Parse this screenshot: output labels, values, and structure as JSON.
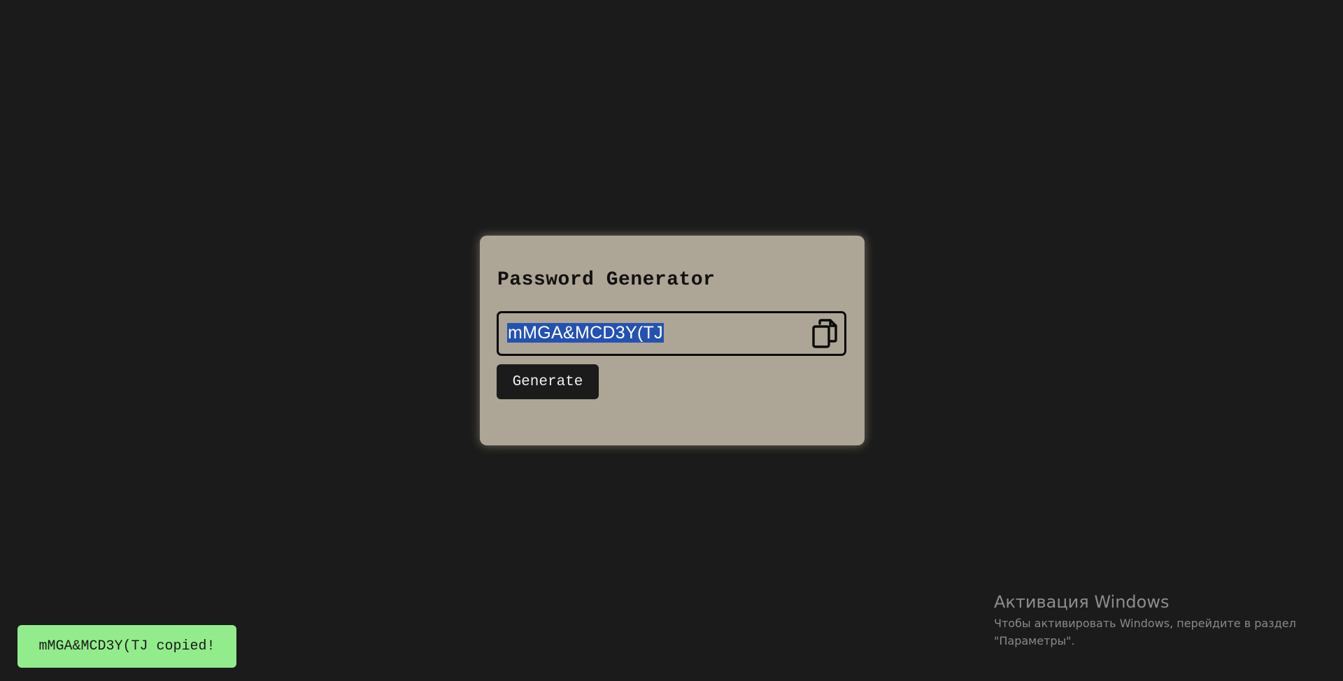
{
  "app": {
    "title": "Password Generator"
  },
  "password_field": {
    "value": "mMGA&MCD3Y(TJ",
    "selected": true,
    "selection_color": "#2452b3"
  },
  "copy_button": {
    "icon": "copy-icon"
  },
  "generate_button": {
    "label": "Generate"
  },
  "toast": {
    "message": "mMGA&MCD3Y(TJ copied!",
    "color": "#92ec8c"
  },
  "windows_watermark": {
    "title": "Активация Windows",
    "text": "Чтобы активировать Windows, перейдите в раздел \"Параметры\"."
  },
  "colors": {
    "background": "#1b1b1b",
    "card": "#ada595",
    "button": "#1b1b1b"
  }
}
